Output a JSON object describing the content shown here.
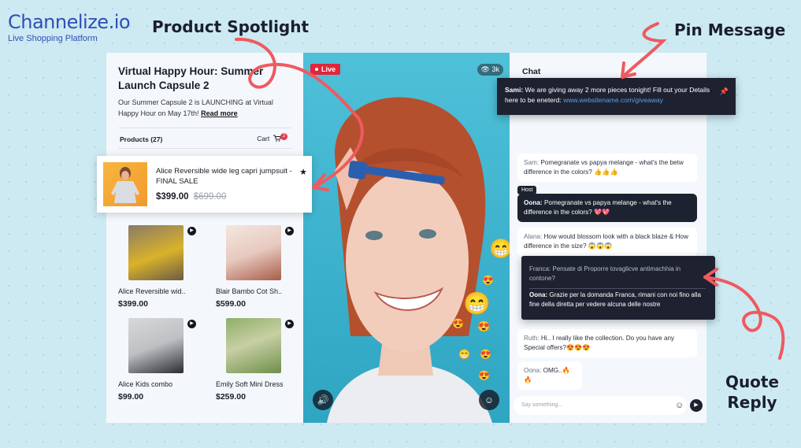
{
  "brand": {
    "logo": "Channelize.io",
    "tagline": "Live Shopping Platform"
  },
  "callouts": {
    "spotlight": "Product Spotlight",
    "pin": "Pin Message",
    "quote_line1": "Quote",
    "quote_line2": "Reply"
  },
  "event": {
    "title": "Virtual Happy Hour: Summer Launch Capsule 2",
    "description": "Our Summer Capsule 2 is LAUNCHING at Virtual Happy Hour on May 17th!",
    "read_more": "Read more"
  },
  "products_bar": {
    "label": "Products (27)",
    "cart": "Cart",
    "cart_count": "2"
  },
  "spotlight": {
    "name": "Alice Reversible wide leg capri jumpsuit - FINAL SALE",
    "price": "$399.00",
    "old_price": "$699.00"
  },
  "products": [
    {
      "name": "Alice Reversible wid..",
      "price": "$399.00"
    },
    {
      "name": "Blair Bambo Cot Sh..",
      "price": "$599.00"
    },
    {
      "name": "Alice Kids combo",
      "price": "$99.00"
    },
    {
      "name": "Emily Soft Mini Dress",
      "price": "$259.00"
    }
  ],
  "video": {
    "live": "Live",
    "viewers": "3k"
  },
  "chat": {
    "title": "Chat",
    "host_tag": "Host",
    "input_placeholder": "Say something...",
    "pinned": {
      "sender": "Sami:",
      "text": "We are giving away 2 more pieces tonight! Fill out your Details here to be eneterd:",
      "link": "www.websitename.com/giveaway"
    },
    "messages": [
      {
        "who": "Sam:",
        "text": "Pomegranate vs papya melange - what's the betw difference in the colors? 👍👍👍"
      },
      {
        "who": "Oona:",
        "text": "Pomegranate vs papya melange - what's the difference in the colors? 💖💖"
      },
      {
        "who": "Alana:",
        "text": "How would blossom look with a black blaze & How difference in the size? 😱😱😱"
      },
      {
        "who": "Ruth:",
        "text": "Hi.. I really like the collection. Do you have any Special offers?😍😍😍"
      },
      {
        "who": "Oona:",
        "text": "OMG..🔥🔥"
      }
    ],
    "quote": {
      "orig_who": "Franca:",
      "orig_text": "Pensate di Proporre tovaglicve antimachhia in contone?",
      "reply_who": "Oona:",
      "reply_text": "Grazie per la domanda Franca, rimani con noi fino alla fine della diretta per vedere alcuna delle nostre"
    }
  },
  "colors": {
    "accent_red": "#e1253b",
    "arrow_red": "#ef5a5f",
    "dark": "#1e2230",
    "link": "#58a2e6",
    "brand": "#2f4fb3"
  }
}
